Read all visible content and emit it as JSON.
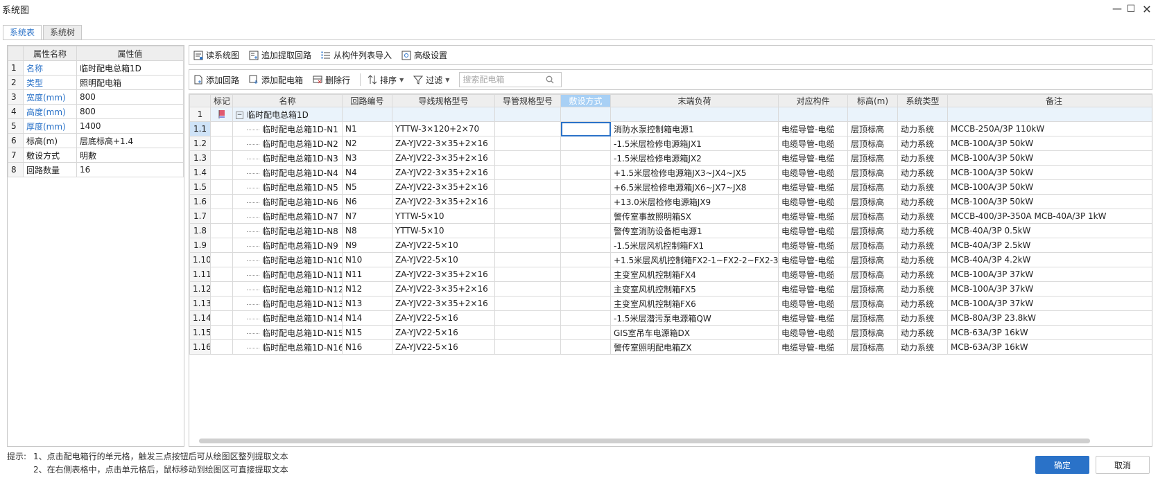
{
  "window": {
    "title": "系统图",
    "min_icon": "minimize-icon",
    "max_icon": "maximize-icon",
    "close_icon": "close-icon"
  },
  "tabs": [
    {
      "label": "系统表",
      "active": true
    },
    {
      "label": "系统树",
      "active": false
    }
  ],
  "properties": {
    "headers": [
      "属性名称",
      "属性值"
    ],
    "rows": [
      {
        "idx": "1",
        "key": "名称",
        "value": "临时配电总箱1D",
        "highlight": true
      },
      {
        "idx": "2",
        "key": "类型",
        "value": "照明配电箱",
        "highlight": true
      },
      {
        "idx": "3",
        "key": "宽度(mm)",
        "value": "800",
        "highlight": true
      },
      {
        "idx": "4",
        "key": "高度(mm)",
        "value": "800",
        "highlight": true
      },
      {
        "idx": "5",
        "key": "厚度(mm)",
        "value": "1400",
        "highlight": true
      },
      {
        "idx": "6",
        "key": "标高(m)",
        "value": "层底标高+1.4",
        "highlight": false
      },
      {
        "idx": "7",
        "key": "敷设方式",
        "value": "明敷",
        "highlight": false
      },
      {
        "idx": "8",
        "key": "回路数量",
        "value": "16",
        "highlight": false
      }
    ]
  },
  "toolbar1": {
    "read_system": "读系统图",
    "append_extract": "追加提取回路",
    "import_from_list": "从构件列表导入",
    "advanced": "高级设置"
  },
  "toolbar2": {
    "add_circuit": "添加回路",
    "add_box": "添加配电箱",
    "delete_row": "删除行",
    "sort": "排序",
    "filter": "过滤",
    "search_placeholder": "搜索配电箱"
  },
  "grid": {
    "headers": [
      "",
      "标记",
      "名称",
      "回路编号",
      "导线规格型号",
      "导管规格型号",
      "敷设方式",
      "末端负荷",
      "对应构件",
      "标高(m)",
      "系统类型",
      "备注"
    ],
    "selected_column": 6,
    "parent": {
      "rn": "1",
      "name": "临时配电总箱1D"
    },
    "rows": [
      {
        "rn": "1.1",
        "name": "临时配电总箱1D-N1",
        "circuit": "N1",
        "wire": "YTTW-3×120+2×70",
        "conduit": "",
        "laying": "",
        "load": "消防水泵控制箱电源1",
        "component": "电缆导管-电缆",
        "elev": "层顶标高",
        "sys": "动力系统",
        "note": "MCCB-250A/3P 110kW"
      },
      {
        "rn": "1.2",
        "name": "临时配电总箱1D-N2",
        "circuit": "N2",
        "wire": "ZA-YJV22-3×35+2×16",
        "conduit": "",
        "laying": "",
        "load": "-1.5米层检修电源箱JX1",
        "component": "电缆导管-电缆",
        "elev": "层顶标高",
        "sys": "动力系统",
        "note": "MCB-100A/3P 50kW"
      },
      {
        "rn": "1.3",
        "name": "临时配电总箱1D-N3",
        "circuit": "N3",
        "wire": "ZA-YJV22-3×35+2×16",
        "conduit": "",
        "laying": "",
        "load": "-1.5米层检修电源箱JX2",
        "component": "电缆导管-电缆",
        "elev": "层顶标高",
        "sys": "动力系统",
        "note": "MCB-100A/3P 50kW"
      },
      {
        "rn": "1.4",
        "name": "临时配电总箱1D-N4",
        "circuit": "N4",
        "wire": "ZA-YJV22-3×35+2×16",
        "conduit": "",
        "laying": "",
        "load": "+1.5米层检修电源箱JX3~JX4~JX5",
        "component": "电缆导管-电缆",
        "elev": "层顶标高",
        "sys": "动力系统",
        "note": "MCB-100A/3P 50kW"
      },
      {
        "rn": "1.5",
        "name": "临时配电总箱1D-N5",
        "circuit": "N5",
        "wire": "ZA-YJV22-3×35+2×16",
        "conduit": "",
        "laying": "",
        "load": "+6.5米层检修电源箱JX6~JX7~JX8",
        "component": "电缆导管-电缆",
        "elev": "层顶标高",
        "sys": "动力系统",
        "note": "MCB-100A/3P 50kW"
      },
      {
        "rn": "1.6",
        "name": "临时配电总箱1D-N6",
        "circuit": "N6",
        "wire": "ZA-YJV22-3×35+2×16",
        "conduit": "",
        "laying": "",
        "load": "+13.0米层检修电源箱JX9",
        "component": "电缆导管-电缆",
        "elev": "层顶标高",
        "sys": "动力系统",
        "note": "MCB-100A/3P 50kW"
      },
      {
        "rn": "1.7",
        "name": "临时配电总箱1D-N7",
        "circuit": "N7",
        "wire": "YTTW-5×10",
        "conduit": "",
        "laying": "",
        "load": "警传室事故照明箱SX",
        "component": "电缆导管-电缆",
        "elev": "层顶标高",
        "sys": "动力系统",
        "note": "MCCB-400/3P-350A MCB-40A/3P 1kW"
      },
      {
        "rn": "1.8",
        "name": "临时配电总箱1D-N8",
        "circuit": "N8",
        "wire": "YTTW-5×10",
        "conduit": "",
        "laying": "",
        "load": "警传室消防设备柜电源1",
        "component": "电缆导管-电缆",
        "elev": "层顶标高",
        "sys": "动力系统",
        "note": "MCB-40A/3P 0.5kW"
      },
      {
        "rn": "1.9",
        "name": "临时配电总箱1D-N9",
        "circuit": "N9",
        "wire": "ZA-YJV22-5×10",
        "conduit": "",
        "laying": "",
        "load": "-1.5米层风机控制箱FX1",
        "component": "电缆导管-电缆",
        "elev": "层顶标高",
        "sys": "动力系统",
        "note": "MCB-40A/3P 2.5kW"
      },
      {
        "rn": "1.10",
        "name": "临时配电总箱1D-N10",
        "circuit": "N10",
        "wire": "ZA-YJV22-5×10",
        "conduit": "",
        "laying": "",
        "load": "+1.5米层风机控制箱FX2-1~FX2-2~FX2-3",
        "component": "电缆导管-电缆",
        "elev": "层顶标高",
        "sys": "动力系统",
        "note": "MCB-40A/3P 4.2kW"
      },
      {
        "rn": "1.11",
        "name": "临时配电总箱1D-N11",
        "circuit": "N11",
        "wire": "ZA-YJV22-3×35+2×16",
        "conduit": "",
        "laying": "",
        "load": "主变室风机控制箱FX4",
        "component": "电缆导管-电缆",
        "elev": "层顶标高",
        "sys": "动力系统",
        "note": "MCB-100A/3P 37kW"
      },
      {
        "rn": "1.12",
        "name": "临时配电总箱1D-N12",
        "circuit": "N12",
        "wire": "ZA-YJV22-3×35+2×16",
        "conduit": "",
        "laying": "",
        "load": "主变室风机控制箱FX5",
        "component": "电缆导管-电缆",
        "elev": "层顶标高",
        "sys": "动力系统",
        "note": "MCB-100A/3P 37kW"
      },
      {
        "rn": "1.13",
        "name": "临时配电总箱1D-N13",
        "circuit": "N13",
        "wire": "ZA-YJV22-3×35+2×16",
        "conduit": "",
        "laying": "",
        "load": "主变室风机控制箱FX6",
        "component": "电缆导管-电缆",
        "elev": "层顶标高",
        "sys": "动力系统",
        "note": "MCB-100A/3P 37kW"
      },
      {
        "rn": "1.14",
        "name": "临时配电总箱1D-N14",
        "circuit": "N14",
        "wire": "ZA-YJV22-5×16",
        "conduit": "",
        "laying": "",
        "load": "-1.5米层潜污泵电源箱QW",
        "component": "电缆导管-电缆",
        "elev": "层顶标高",
        "sys": "动力系统",
        "note": "MCB-80A/3P 23.8kW"
      },
      {
        "rn": "1.15",
        "name": "临时配电总箱1D-N15",
        "circuit": "N15",
        "wire": "ZA-YJV22-5×16",
        "conduit": "",
        "laying": "",
        "load": "GIS室吊车电源箱DX",
        "component": "电缆导管-电缆",
        "elev": "层顶标高",
        "sys": "动力系统",
        "note": "MCB-63A/3P 16kW"
      },
      {
        "rn": "1.16",
        "name": "临时配电总箱1D-N16",
        "circuit": "N16",
        "wire": "ZA-YJV22-5×16",
        "conduit": "",
        "laying": "",
        "load": "警传室照明配电箱ZX",
        "component": "电缆导管-电缆",
        "elev": "层顶标高",
        "sys": "动力系统",
        "note": "MCB-63A/3P 16kW"
      }
    ]
  },
  "hints": {
    "label": "提示:",
    "line1": "1、点击配电箱行的单元格，触发三点按钮后可从绘图区整列提取文本",
    "line2": "2、在右侧表格中，点击单元格后，鼠标移动到绘图区可直接提取文本"
  },
  "buttons": {
    "ok": "确定",
    "cancel": "取消"
  },
  "colors": {
    "accent": "#2a72c8",
    "selected_header": "#a8d0f5",
    "parent_row": "#eaf3fb"
  }
}
